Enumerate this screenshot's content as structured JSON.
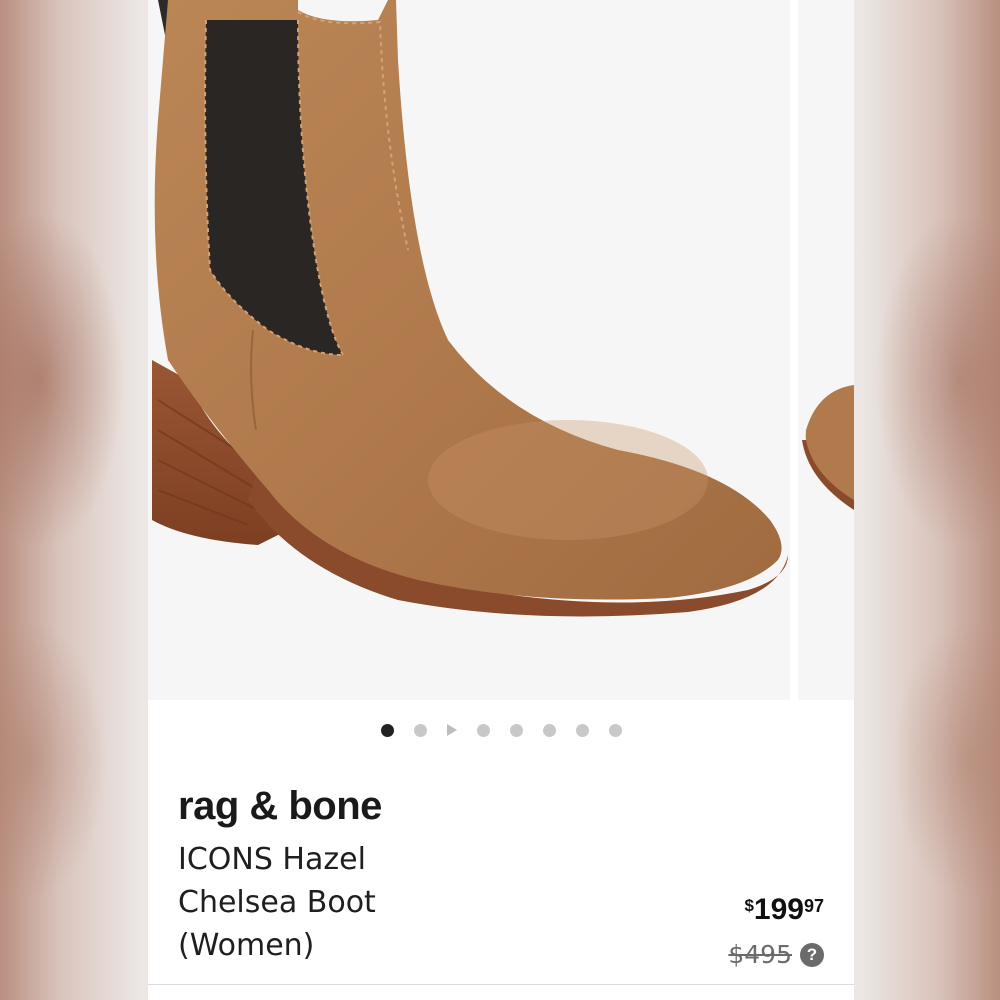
{
  "product": {
    "brand": "rag & bone",
    "name": "ICONS Hazel Chelsea Boot (Women)",
    "price": {
      "currency": "$",
      "dollars": "199",
      "cents": "97"
    },
    "original_price": "$495",
    "help_icon_label": "?"
  },
  "gallery": {
    "images": [
      {
        "icon": "boot-photo"
      },
      {
        "icon": "boot-photo"
      }
    ],
    "pager": {
      "total_dots": 8,
      "active_index": 0,
      "video_index": 2
    }
  },
  "colors": {
    "suede": "#b07a4c",
    "elastic": "#2a2624",
    "heel": "#8a4a2c",
    "active_dot": "#222222",
    "inactive_dot": "#c8c8c8"
  }
}
